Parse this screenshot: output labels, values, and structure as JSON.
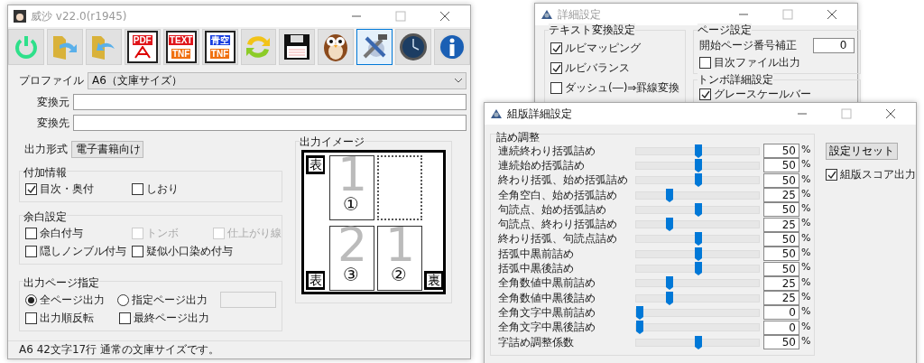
{
  "main_window": {
    "title": "威沙 v22.0(r1945)",
    "active": false,
    "toolbar": [
      {
        "kind": "power",
        "selected": false
      },
      {
        "kind": "folder-forward",
        "selected": false
      },
      {
        "kind": "folder-back",
        "selected": false
      },
      {
        "kind": "pdf",
        "top": "PDF",
        "selected": false
      },
      {
        "kind": "tnf",
        "top": "TEXT",
        "bottom": "TNF",
        "selected": false
      },
      {
        "kind": "tnf-blue",
        "top": "青空",
        "bottom": "TNF",
        "selected": false
      },
      {
        "kind": "refresh",
        "selected": false
      },
      {
        "kind": "save",
        "selected": false
      },
      {
        "kind": "owl",
        "selected": false
      },
      {
        "kind": "tools",
        "selected": true
      },
      {
        "kind": "clock",
        "selected": false
      },
      {
        "kind": "info",
        "selected": false
      }
    ],
    "profile": {
      "label": "プロファイル",
      "value": "A6（文庫サイズ）"
    },
    "source": {
      "label": "変換元"
    },
    "destination": {
      "label": "変換先"
    },
    "output_format": {
      "label": "出力形式",
      "value": "電子書籍向け"
    },
    "extra_info": {
      "title": "付加情報",
      "options": [
        {
          "label": "目次・奥付",
          "checked": true,
          "disabled": false
        },
        {
          "label": "しおり",
          "checked": false,
          "disabled": false
        }
      ]
    },
    "margin": {
      "title": "余白設定",
      "options": [
        {
          "label": "余白付与",
          "checked": false,
          "disabled": false
        },
        {
          "label": "トンボ",
          "checked": false,
          "disabled": true
        },
        {
          "label": "仕上がり線",
          "checked": false,
          "disabled": true
        },
        {
          "label": "隠しノンブル付与",
          "checked": false,
          "disabled": false
        },
        {
          "label": "疑似小口染め付与",
          "checked": false,
          "disabled": false
        }
      ]
    },
    "page_output": {
      "title": "出力ページ指定",
      "modes": [
        {
          "label": "全ページ出力",
          "selected": true
        },
        {
          "label": "指定ページ出力",
          "selected": false
        }
      ],
      "page_range": {
        "disabled": true
      },
      "options": [
        {
          "label": "出力順反転",
          "checked": false,
          "disabled": false
        },
        {
          "label": "最終ページ出力",
          "checked": false,
          "disabled": false
        }
      ]
    },
    "output_image": {
      "title": "出力イメージ",
      "markers": [
        {
          "text": "表"
        },
        {
          "text": "表"
        },
        {
          "text": "裏"
        }
      ],
      "pages": [
        {
          "kind": "page",
          "number": "1",
          "order": "①"
        },
        {
          "kind": "empty"
        },
        {
          "kind": "page",
          "number": "2",
          "order": "③"
        },
        {
          "kind": "page",
          "number": "1",
          "order": "②"
        }
      ]
    },
    "status": "A6 42文字17行 通常の文庫サイズです。"
  },
  "detail_window": {
    "title": "詳細設定",
    "active": false,
    "text_conversion": {
      "title": "テキスト変換設定",
      "options": [
        {
          "label": "ルビマッピング",
          "checked": true,
          "disabled": false
        },
        {
          "label": "ルビバランス",
          "checked": true,
          "disabled": false
        },
        {
          "label": "ダッシュ(―)⇒罫線変換",
          "checked": false,
          "disabled": false
        }
      ]
    },
    "page_settings": {
      "title": "ページ設定",
      "start_page_label": "開始ページ番号補正",
      "start_page_value": "0",
      "options": [
        {
          "label": "目次ファイル出力",
          "checked": false,
          "disabled": false
        }
      ]
    },
    "crop_marks": {
      "title": "トンボ詳細設定",
      "options": [
        {
          "label": "グレースケールバー",
          "checked": true,
          "disabled": false
        }
      ]
    }
  },
  "typeset_window": {
    "title": "組版詳細設定",
    "active": true,
    "group_title": "詰め調整",
    "rows": [
      {
        "label": "連続終わり括弧詰め",
        "level": 0.5,
        "value": "50",
        "unit": "%"
      },
      {
        "label": "連続始め括弧詰め",
        "level": 0.5,
        "value": "50",
        "unit": "%"
      },
      {
        "label": "終わり括弧、始め括弧詰め",
        "level": 0.5,
        "value": "50",
        "unit": "%"
      },
      {
        "label": "全角空白、始め括弧詰め",
        "level": 0.25,
        "value": "25",
        "unit": "%"
      },
      {
        "label": "句読点、始め括弧詰め",
        "level": 0.5,
        "value": "50",
        "unit": "%"
      },
      {
        "label": "句読点、終わり括弧詰め",
        "level": 0.25,
        "value": "25",
        "unit": "%"
      },
      {
        "label": "終わり括弧、句読点詰め",
        "level": 0.5,
        "value": "50",
        "unit": "%"
      },
      {
        "label": "括弧中黒前詰め",
        "level": 0.5,
        "value": "50",
        "unit": "%"
      },
      {
        "label": "括弧中黒後詰め",
        "level": 0.5,
        "value": "50",
        "unit": "%"
      },
      {
        "label": "全角数値中黒前詰め",
        "level": 0.25,
        "value": "25",
        "unit": "%"
      },
      {
        "label": "全角数値中黒後詰め",
        "level": 0.25,
        "value": "25",
        "unit": "%"
      },
      {
        "label": "全角文字中黒前詰め",
        "level": 0,
        "value": "0",
        "unit": "%"
      },
      {
        "label": "全角文字中黒後詰め",
        "level": 0,
        "value": "0",
        "unit": "%"
      },
      {
        "label": "字詰め調整係数",
        "level": 0.5,
        "value": "50",
        "unit": "%"
      }
    ],
    "reset_button": "設定リセット",
    "score_output": {
      "label": "組版スコア出力",
      "checked": true,
      "disabled": false
    }
  }
}
